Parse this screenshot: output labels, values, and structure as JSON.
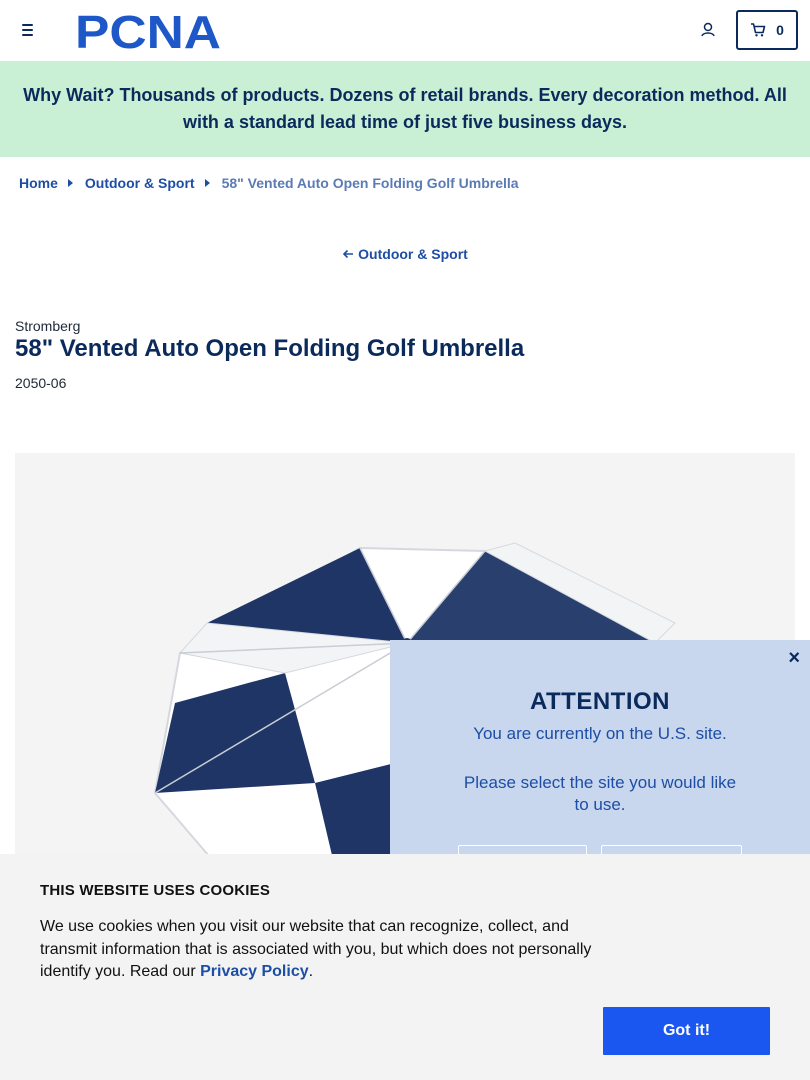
{
  "header": {
    "logo_text": "PCNA",
    "cart_count": "0"
  },
  "promo": {
    "text": "Why Wait? Thousands of products. Dozens of retail brands. Every decoration method. All with a standard lead time of just five business days."
  },
  "breadcrumb": {
    "items": [
      "Home",
      "Outdoor & Sport",
      "58\" Vented Auto Open Folding Golf Umbrella"
    ]
  },
  "back_link": "Outdoor & Sport",
  "product": {
    "brand": "Stromberg",
    "title": "58\" Vented Auto Open Folding Golf Umbrella",
    "sku": "2050-06",
    "colors": {
      "navy": "#1e3566",
      "white": "#ffffff"
    }
  },
  "attention_modal": {
    "close": "×",
    "heading": "ATTENTION",
    "line1": "You are currently on the U.S. site.",
    "line2": "Please select the site you would like to use."
  },
  "cookie_banner": {
    "heading": "THIS WEBSITE USES COOKIES",
    "body": "We use cookies when you visit our website that can recognize, collect, and transmit information that is associated with you, but which does not personally identify you. Read our ",
    "link": "Privacy Policy",
    "tail": ".",
    "button": "Got it!"
  },
  "colors": {
    "brand_navy": "#0b2a5c",
    "link_blue": "#1d4ea5",
    "promo_bg": "#c9efd5",
    "modal_bg": "#c8d6ee",
    "cookie_button": "#1a56f0"
  }
}
